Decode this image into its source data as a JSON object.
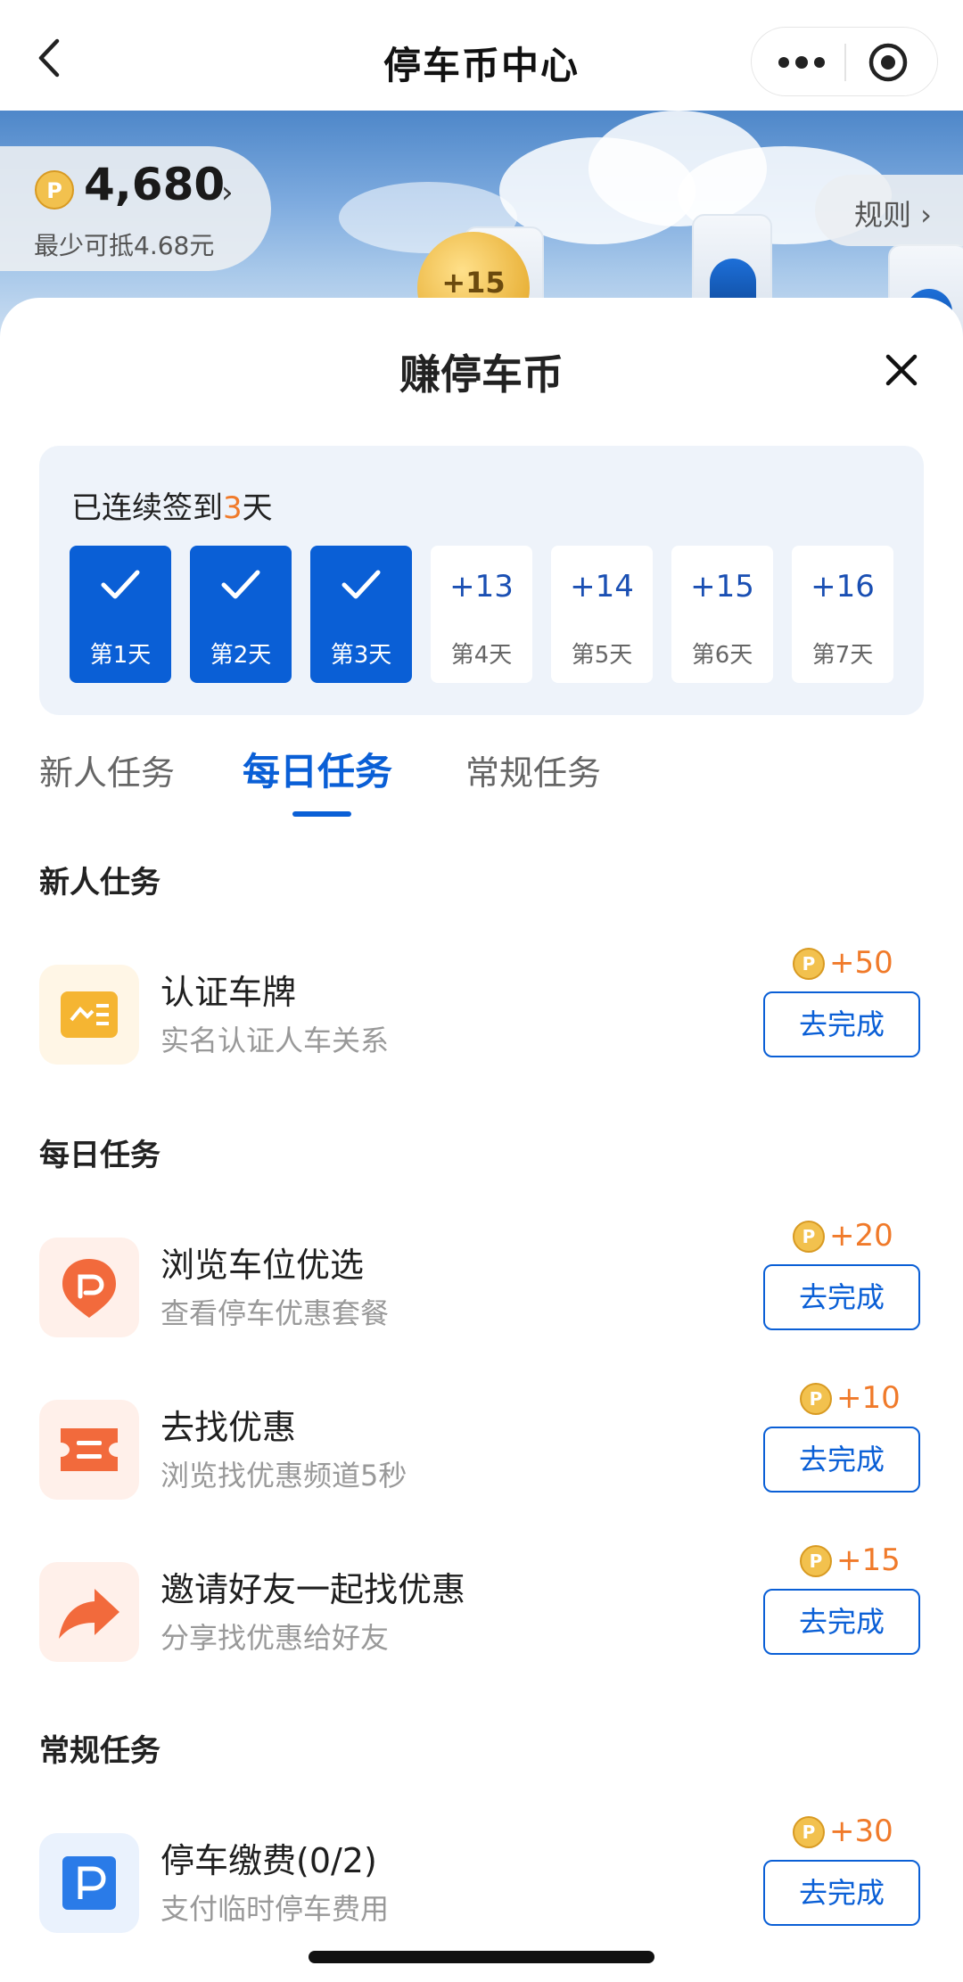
{
  "nav": {
    "title": "停车币中心"
  },
  "hero": {
    "balance": "4,680",
    "balance_arrow": "›",
    "balance_sub": "最少可抵4.68元",
    "rules_label": "规则 ›",
    "bubble_value": "+15",
    "coin_color": "#f2c14e"
  },
  "sheet": {
    "title": "赚停车币",
    "signin": {
      "prefix": "已连续签到",
      "days_count": "3",
      "suffix": "天",
      "days": [
        {
          "label": "第1天",
          "done": true
        },
        {
          "label": "第2天",
          "done": true
        },
        {
          "label": "第3天",
          "done": true
        },
        {
          "label": "第4天",
          "reward": "+13"
        },
        {
          "label": "第5天",
          "reward": "+14"
        },
        {
          "label": "第6天",
          "reward": "+15"
        },
        {
          "label": "第7天",
          "reward": "+16"
        }
      ]
    },
    "tabs": [
      {
        "label": "新人任务",
        "active": false
      },
      {
        "label": "每日任务",
        "active": true
      },
      {
        "label": "常规任务",
        "active": false
      }
    ],
    "sections": {
      "newbie": "新人仕务",
      "daily": "每日任务",
      "regular": "常规任务"
    },
    "tasks": [
      {
        "title": "认证车牌",
        "sub": "实名认证人车关系",
        "reward": "+50",
        "button": "去完成",
        "icon": "license-card-icon"
      },
      {
        "title": "浏览车位优选",
        "sub": "查看停车优惠套餐",
        "reward": "+20",
        "button": "去完成",
        "icon": "parking-pin-icon"
      },
      {
        "title": "去找优惠",
        "sub": "浏览找优惠频道5秒",
        "reward": "+10",
        "button": "去完成",
        "icon": "coupon-ticket-icon"
      },
      {
        "title": "邀请好友一起找优惠",
        "sub": "分享找优惠给好友",
        "reward": "+15",
        "button": "去完成",
        "icon": "share-arrow-icon"
      },
      {
        "title": "停车缴费(0/2)",
        "sub": "支付临时停车费用",
        "reward": "+30",
        "button": "去完成",
        "icon": "parking-p-icon"
      }
    ]
  },
  "colors": {
    "primary": "#0a5fd6",
    "accent": "#f07a2a",
    "coin": "#f2c14e"
  }
}
